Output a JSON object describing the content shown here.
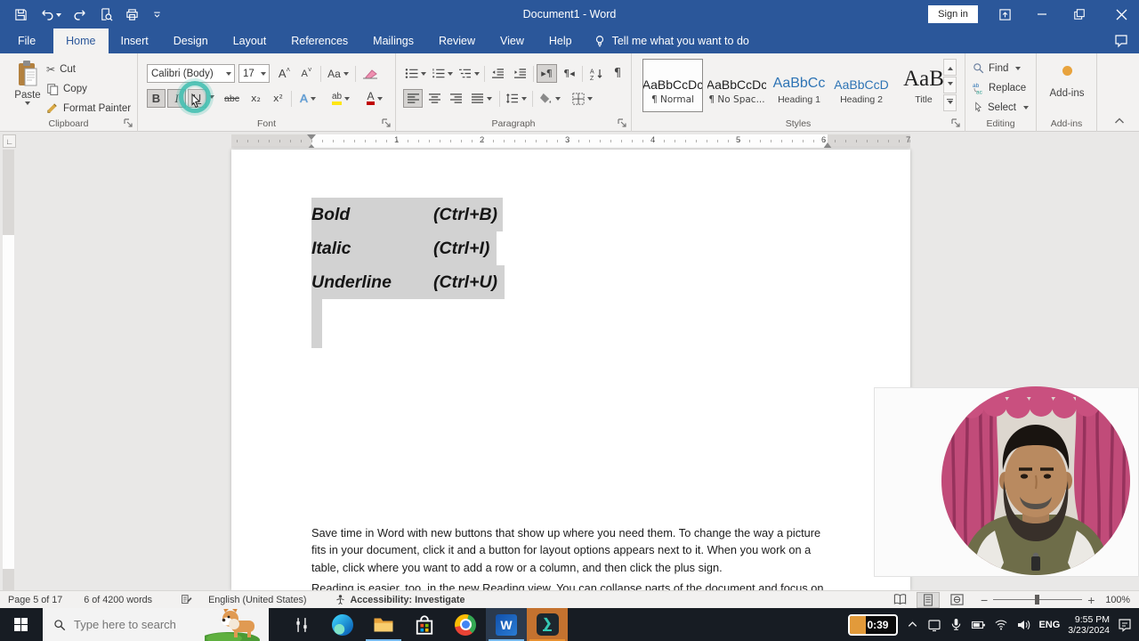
{
  "titlebar": {
    "title": "Document1  -  Word",
    "sign_in": "Sign in"
  },
  "ribbon_tabs": [
    "File",
    "Home",
    "Insert",
    "Design",
    "Layout",
    "References",
    "Mailings",
    "Review",
    "View",
    "Help"
  ],
  "tell_me": "Tell me what you want to do",
  "clipboard": {
    "label": "Clipboard",
    "paste": "Paste",
    "cut": "Cut",
    "copy": "Copy",
    "format_painter": "Format Painter"
  },
  "font": {
    "label": "Font",
    "family": "Calibri (Body)",
    "size": "17",
    "grow": "A",
    "shrink": "A",
    "change_case": "Aa",
    "bold": "B",
    "italic": "I",
    "underline": "U",
    "strikethrough": "abc",
    "subscript": "x₂",
    "superscript": "x²",
    "text_effects": "A",
    "highlight": "ab",
    "font_color": "A"
  },
  "paragraph": {
    "label": "Paragraph"
  },
  "styles": {
    "label": "Styles",
    "normal_preview": "AaBbCcDc",
    "normal": "¶ Normal",
    "nospace_preview": "AaBbCcDc",
    "nospace": "¶ No Spac...",
    "h1_preview": "AaBbCc",
    "h1": "Heading 1",
    "h2_preview": "AaBbCcD",
    "h2": "Heading 2",
    "title_preview": "AaB",
    "title": "Title"
  },
  "editing": {
    "label": "Editing",
    "find": "Find",
    "replace": "Replace",
    "select": "Select"
  },
  "addins": {
    "label": "Add-ins",
    "button": "Add-ins"
  },
  "ruler_numbers": [
    "1",
    "2",
    "3",
    "4",
    "5",
    "6",
    "7"
  ],
  "document": {
    "line1_name": "Bold",
    "line1_keys": "(Ctrl+B)",
    "line2_name": "Italic",
    "line2_keys": "(Ctrl+I)",
    "line3_name": "Underline",
    "line3_keys": "(Ctrl+U)",
    "paragraph1": "Save time in Word with new buttons that show up where you need them. To change the way a picture fits in your document, click it and a button for layout options appears next to it. When you work on a table, click where you want to add a row or a column, and then click the plus sign.",
    "paragraph2": "Reading is easier, too, in the new Reading view. You can collapse parts of the document and focus on the"
  },
  "statusbar": {
    "page": "Page 5 of 17",
    "words": "6 of 4200 words",
    "language": "English (United States)",
    "accessibility": "Accessibility: Investigate",
    "zoom": "100%"
  },
  "taskbar": {
    "search_placeholder": "Type here to search",
    "timer": "0:39",
    "language": "ENG",
    "time": "9:55 PM",
    "date": "3/23/2024"
  }
}
